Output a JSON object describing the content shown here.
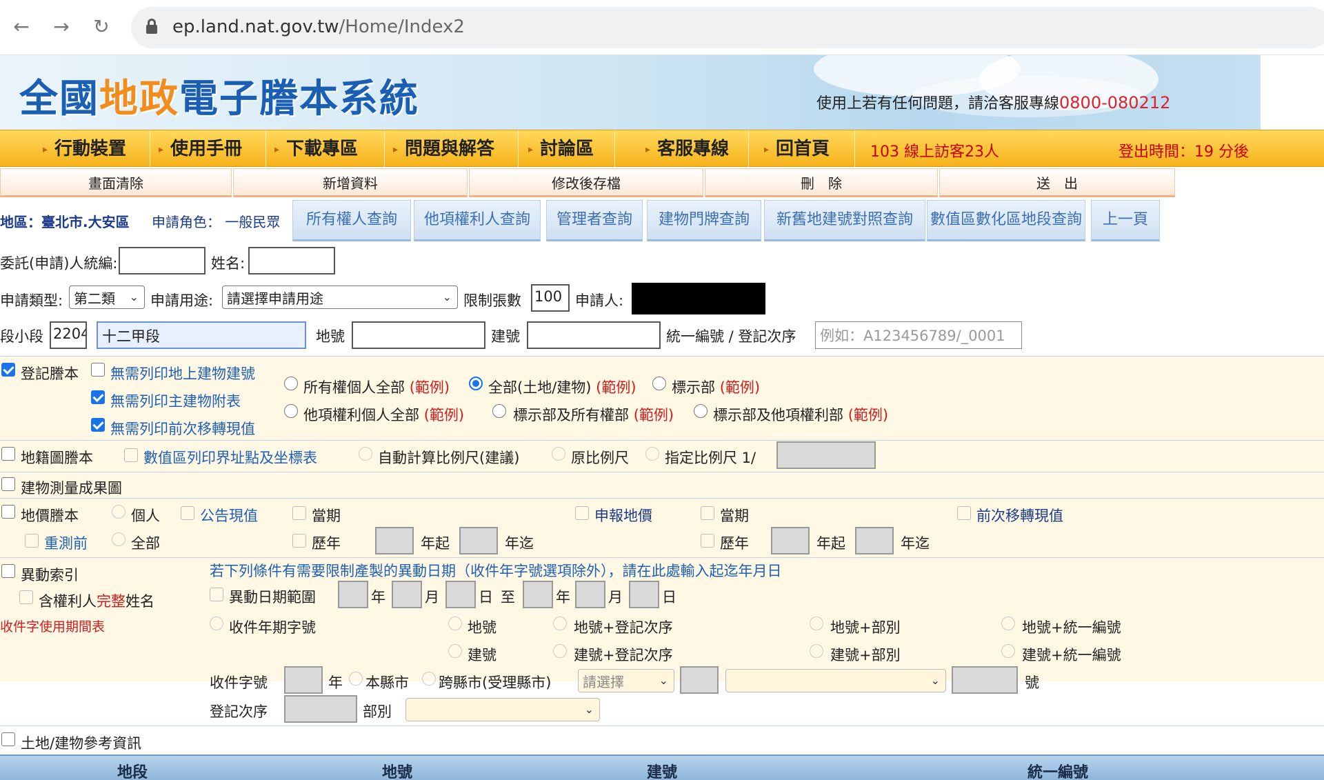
{
  "browser": {
    "url_host": "ep.land.nat.gov.tw",
    "url_path": "/Home/Index2"
  },
  "banner": {
    "title_a": "全國",
    "title_b": "地政",
    "title_c": "電子謄本系統",
    "contact_text": "使用上若有任何問題，請洽客服專線",
    "contact_phone": "0800-080212"
  },
  "menu": {
    "items": [
      "行動裝置",
      "使用手冊",
      "下載專區",
      "問題與解答",
      "討論區",
      "客服專線",
      "回首頁"
    ],
    "visitors": "103  線上訪客23人",
    "logout": "登出時間：19 分後"
  },
  "actions": [
    "畫面清除",
    "新增資料",
    "修改後存檔",
    "刪　除",
    "送　出"
  ],
  "query": {
    "region": "地區：臺北市.大安區",
    "role": "申請角色： 一般民眾",
    "tabs": [
      "所有權人查詢",
      "他項權利人查詢",
      "管理者查詢",
      "建物門牌查詢",
      "新舊地建號對照查詢",
      "數值區數化區地段查詢",
      "上一頁"
    ]
  },
  "form": {
    "delegate_id_label": "委託(申請)人統編:",
    "name_label": "姓名:",
    "apply_type_label": "申請類型:",
    "apply_type_value": "第二類",
    "purpose_label": "申請用途:",
    "purpose_value": "請選擇申請用途",
    "limit_label": "限制張數",
    "limit_value": "100",
    "applicant_label": "申請人:",
    "section_label": "段小段",
    "section_code": "2204",
    "section_name": "十二甲段",
    "land_no_label": "地號",
    "building_no_label": "建號",
    "uid_label": "統一編號 / 登記次序",
    "uid_placeholder": "例如：A123456789/_0001"
  },
  "register": {
    "label": "登記謄本",
    "opt1": "無需列印地上建物建號",
    "opt2": "無需列印主建物附表",
    "opt3": "無需列印前次移轉現值",
    "r1": "所有權個人全部",
    "r2": "全部(土地/建物)",
    "r3": "標示部",
    "r4": "他項權利個人全部",
    "r5": "標示部及所有權部",
    "r6": "標示部及他項權利部",
    "example": "(範例)"
  },
  "cadastral": {
    "label": "地籍圖謄本",
    "opt": "數值區列印界址點及坐標表",
    "auto": "自動計算比例尺(建議)",
    "orig": "原比例尺",
    "specify": "指定比例尺 1/"
  },
  "building_survey": {
    "label": "建物測量成果圖"
  },
  "price": {
    "label": "地價謄本",
    "personal": "個人",
    "announced": "公告現值",
    "current": "當期",
    "declared": "申報地價",
    "prev_transfer": "前次移轉現值",
    "resurvey": "重測前",
    "all": "全部",
    "past": "歷年",
    "year_from": "年起",
    "year_to": "年迄"
  },
  "change": {
    "label": "異動索引",
    "include_a": "含權利人",
    "include_b": "完整",
    "include_c": "姓名",
    "period_table": "收件字使用期間表",
    "notice": "若下列條件有需要限制產製的異動日期（收件年字號選項除外），請在此處輸入起迄年月日",
    "date_range": "異動日期範圍",
    "year": "年",
    "month": "月",
    "day": "日",
    "to": "至",
    "opt_receipt": "收件年期字號",
    "opt_land": "地號",
    "opt_land_seq": "地號+登記次序",
    "opt_land_part": "地號+部別",
    "opt_land_uid": "地號+統一編號",
    "opt_bld": "建號",
    "opt_bld_seq": "建號+登記次序",
    "opt_bld_part": "建號+部別",
    "opt_bld_uid": "建號+統一編號",
    "receipt_no": "收件字號",
    "this_county": "本縣市",
    "cross_county": "跨縣市(受理縣市)",
    "select_ph": "請選擇",
    "number": "號",
    "reg_seq": "登記次序",
    "part": "部別"
  },
  "reference": {
    "label": "土地/建物參考資訊"
  },
  "table": {
    "headers": [
      "地段",
      "地號",
      "建號",
      "統一編號"
    ]
  }
}
